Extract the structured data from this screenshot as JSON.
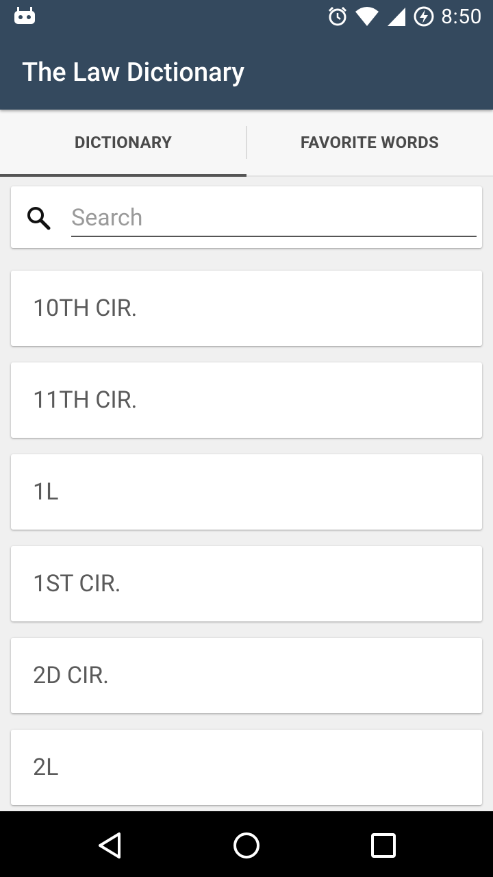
{
  "status_bar": {
    "time": "8:50",
    "icons": [
      "android-debug-icon",
      "alarm-icon",
      "wifi-icon",
      "cell-signal-icon",
      "battery-charging-icon"
    ]
  },
  "toolbar": {
    "title": "The Law Dictionary",
    "background_color": "#34495e"
  },
  "tabs": [
    {
      "label": "DICTIONARY",
      "selected": true
    },
    {
      "label": "FAVORITE WORDS",
      "selected": false
    }
  ],
  "search": {
    "placeholder": "Search",
    "value": ""
  },
  "words": [
    {
      "label": "10TH CIR."
    },
    {
      "label": "11TH CIR."
    },
    {
      "label": "1L"
    },
    {
      "label": "1ST CIR."
    },
    {
      "label": "2D CIR."
    },
    {
      "label": "2L"
    }
  ],
  "nav_bar": {
    "buttons": [
      "back-icon",
      "home-icon",
      "recents-icon"
    ]
  }
}
